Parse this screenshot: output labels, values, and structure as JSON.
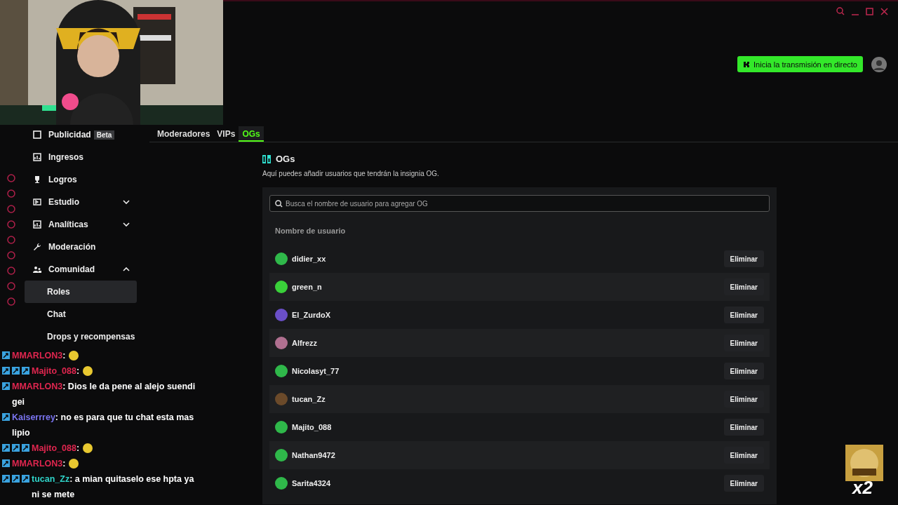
{
  "header": {
    "go_live": "Inicia la transmisión en directo"
  },
  "nav": [
    {
      "kind": "link",
      "label": "Publicidad",
      "badge": "Beta",
      "selected": false
    },
    {
      "kind": "link",
      "label": "Ingresos",
      "selected": false
    },
    {
      "kind": "link",
      "label": "Logros",
      "selected": false
    },
    {
      "kind": "group",
      "label": "Estudio",
      "expanded": false,
      "selected": false
    },
    {
      "kind": "group",
      "label": "Analíticas",
      "expanded": false,
      "selected": false
    },
    {
      "kind": "link",
      "label": "Moderación",
      "selected": false
    },
    {
      "kind": "group",
      "label": "Comunidad",
      "expanded": true,
      "selected": false
    },
    {
      "kind": "sub",
      "label": "Roles",
      "selected": true
    },
    {
      "kind": "sub",
      "label": "Chat",
      "selected": false
    },
    {
      "kind": "sub",
      "label": "Drops y recompensas",
      "selected": false
    }
  ],
  "tabs": [
    {
      "label": "Moderadores",
      "selected": false
    },
    {
      "label": "VIPs",
      "selected": false
    },
    {
      "label": "OGs",
      "selected": true
    }
  ],
  "section": {
    "title": "OGs",
    "description": "Aquí puedes añadir usuarios que tendrán la insignia OG.",
    "search": {
      "placeholder": "Busca el nombre de usuario para agregar OG"
    },
    "column": "Nombre de usuario"
  },
  "users": [
    {
      "name": "didier_xx",
      "color": "#2fb84a",
      "action": "Eliminar"
    },
    {
      "name": "green_n",
      "color": "#3ad13a",
      "action": "Eliminar"
    },
    {
      "name": "El_ZurdoX",
      "color": "#6a4fc8",
      "action": "Eliminar"
    },
    {
      "name": "Alfrezz",
      "color": "#b07090",
      "action": "Eliminar"
    },
    {
      "name": "Nicolasyt_77",
      "color": "#2fb84a",
      "action": "Eliminar"
    },
    {
      "name": "tucan_Zz",
      "color": "#6b4a2a",
      "action": "Eliminar"
    },
    {
      "name": "Majito_088",
      "color": "#2fb84a",
      "action": "Eliminar"
    },
    {
      "name": "Nathan9472",
      "color": "#2fb84a",
      "action": "Eliminar"
    },
    {
      "name": "Sarita4324",
      "color": "#2fb84a",
      "action": "Eliminar"
    }
  ],
  "chat": [
    {
      "kind": "emote",
      "user": "MMARLON3",
      "color": "#e0264f",
      "text": ":"
    },
    {
      "kind": "emote",
      "user": "Majito_088",
      "color": "#e0264f",
      "text": ":"
    },
    {
      "kind": "text",
      "user": "MMARLON3",
      "color": "#e0264f",
      "text": ": Dios le da pene al alejo suendi gei"
    },
    {
      "kind": "text",
      "user": "Kaiserrrey",
      "color": "#7a74f0",
      "text": ": no es para que tu chat esta mas lipio"
    },
    {
      "kind": "emote",
      "user": "Majito_088",
      "color": "#e0264f",
      "text": ":"
    },
    {
      "kind": "emote",
      "user": "MMARLON3",
      "color": "#e0264f",
      "text": ":"
    },
    {
      "kind": "text",
      "user": "tucan_Zz",
      "color": "#2fd3c8",
      "text": ": a mian quitaselo ese hpta ya ni se mete"
    }
  ],
  "alert": {
    "multiplier": "x2"
  }
}
